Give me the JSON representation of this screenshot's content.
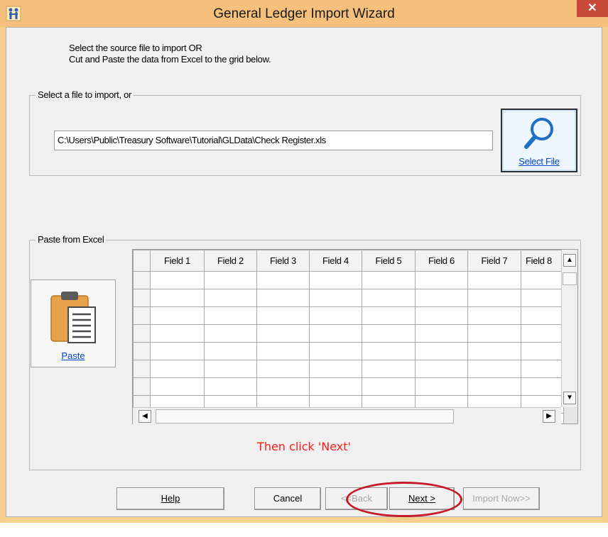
{
  "window": {
    "title": "General Ledger Import Wizard",
    "close_glyph": "✕",
    "app_icon": "tree-person-icon"
  },
  "instructions": {
    "line1": "Select the source file to import OR",
    "line2": "Cut and Paste the data from Excel to the grid below."
  },
  "file_group": {
    "legend": "Select a file to import, or",
    "path_value": "C:\\Users\\Public\\Treasury Software\\Tutorial\\GLData\\Check Register.xls",
    "select_button_label": "Select File",
    "select_button_icon": "magnifier-icon"
  },
  "paste_group": {
    "legend": "Paste from Excel",
    "paste_button_label": "Paste",
    "paste_button_icon": "clipboard-icon",
    "columns": [
      "Field 1",
      "Field 2",
      "Field 3",
      "Field 4",
      "Field 5",
      "Field 6",
      "Field 7",
      "Field 8"
    ],
    "visible_row_count": 9
  },
  "hint": "Then click 'Next'",
  "buttons": {
    "help": "Help",
    "cancel": "Cancel",
    "back": "<<Back",
    "next": "Next >",
    "import_now": "Import Now>>"
  },
  "colors": {
    "title_bar": "#f5c07c",
    "close_button": "#c74a3b",
    "hint_text": "#ff1a1a",
    "highlight_oval": "#c41c2a",
    "link_blue": "#0044cc"
  }
}
